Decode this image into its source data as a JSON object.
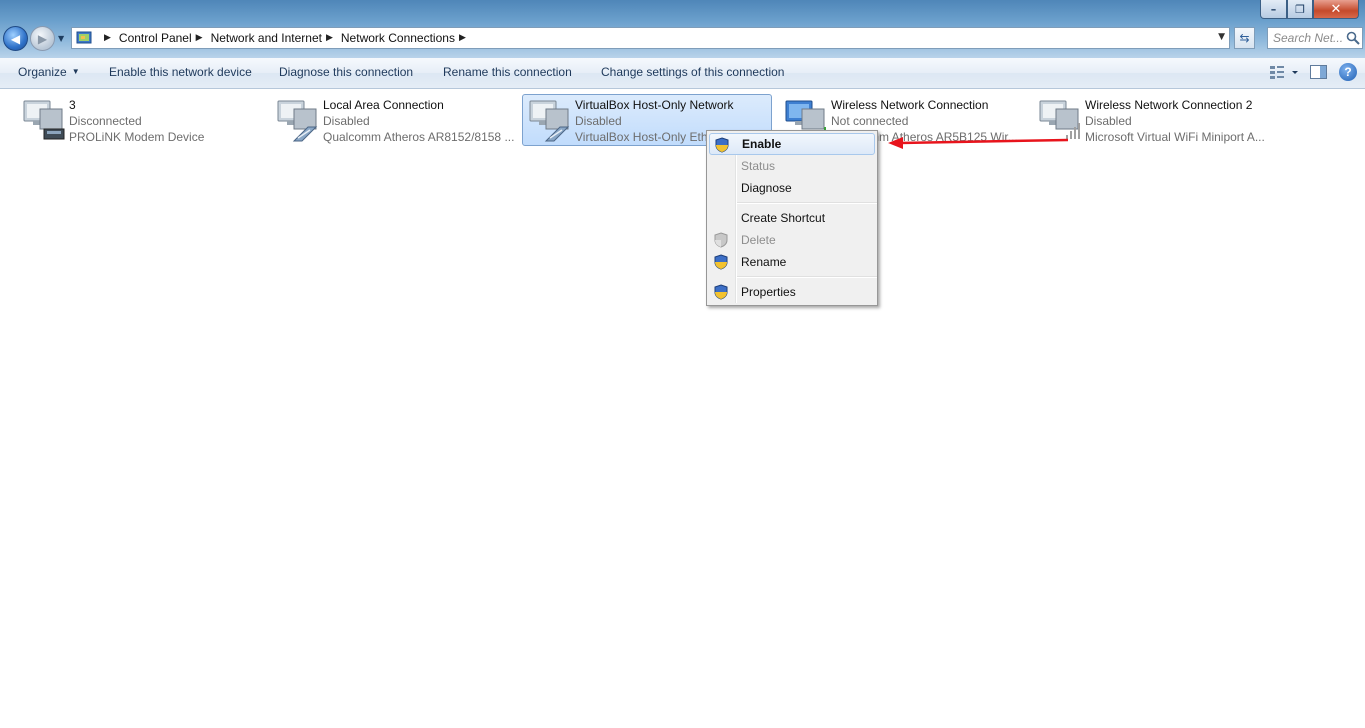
{
  "window": {
    "minimize": "–",
    "maximize": "❐",
    "close": "✕"
  },
  "address_bar": {
    "crumbs": [
      "Control Panel",
      "Network and Internet",
      "Network Connections"
    ],
    "search_placeholder": "Search Net..."
  },
  "command_bar": {
    "organize": "Organize",
    "enable": "Enable this network device",
    "diagnose": "Diagnose this connection",
    "rename": "Rename this connection",
    "change_settings": "Change settings of this connection",
    "help": "?"
  },
  "connections": [
    {
      "name": "3",
      "status": "Disconnected",
      "device": "PROLiNK Modem Device",
      "icon": "modem-connection-icon"
    },
    {
      "name": "Local Area Connection",
      "status": "Disabled",
      "device": "Qualcomm Atheros AR8152/8158 ...",
      "icon": "ethernet-connection-icon"
    },
    {
      "name": "VirtualBox Host-Only Network",
      "status": "Disabled",
      "device": "VirtualBox Host-Only Ethernet Adapter",
      "icon": "ethernet-connection-icon",
      "selected": true
    },
    {
      "name": "Wireless Network Connection",
      "status": "Not connected",
      "device": "Qualcomm Atheros AR5B125 Wir...",
      "icon": "wireless-connection-icon"
    },
    {
      "name": "Wireless Network Connection 2",
      "status": "Disabled",
      "device": "Microsoft Virtual WiFi Miniport A...",
      "icon": "wireless-connection-icon"
    }
  ],
  "context_menu": {
    "enable": "Enable",
    "status": "Status",
    "diagnose": "Diagnose",
    "create_shortcut": "Create Shortcut",
    "delete": "Delete",
    "rename": "Rename",
    "properties": "Properties"
  },
  "colors": {
    "selection": "#c1dcfc",
    "annotation_arrow": "#e8141c"
  }
}
